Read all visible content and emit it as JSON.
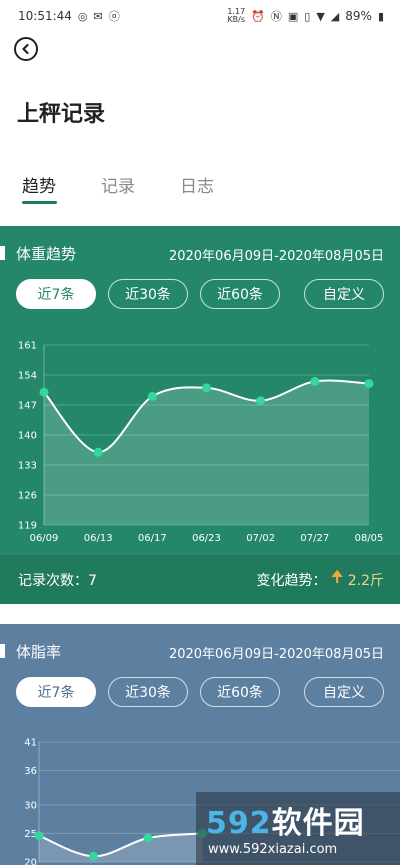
{
  "status_bar": {
    "time": "10:51:44",
    "net_speed_value": "1.17",
    "net_speed_unit": "KB/s",
    "battery": "89%"
  },
  "header": {
    "title": "上秤记录"
  },
  "tabs": [
    {
      "label": "趋势",
      "active": true
    },
    {
      "label": "记录",
      "active": false
    },
    {
      "label": "日志",
      "active": false
    }
  ],
  "colors": {
    "accent": "#1c7d5a",
    "weight_card": "#24876a",
    "fat_card": "#5d7fa0",
    "point": "#35d89a",
    "trend_arrow": "#f2a43a"
  },
  "weight_card": {
    "title": "体重趋势",
    "date_range": "2020年06月09日-2020年08月05日",
    "filters": [
      {
        "label": "近7条",
        "active": true
      },
      {
        "label": "近30条",
        "active": false
      },
      {
        "label": "近60条",
        "active": false
      },
      {
        "label": "自定义",
        "active": false
      }
    ],
    "record_count_label": "记录次数：",
    "record_count": "7",
    "trend_label": "变化趋势：",
    "trend_arrow": "up-arrow-icon",
    "trend_value": "2.2斤"
  },
  "fat_card": {
    "title": "体脂率",
    "date_range": "2020年06月09日-2020年08月05日",
    "filters": [
      {
        "label": "近7条",
        "active": true
      },
      {
        "label": "近30条",
        "active": false
      },
      {
        "label": "近60条",
        "active": false
      },
      {
        "label": "自定义",
        "active": false
      }
    ]
  },
  "chart_data": [
    {
      "type": "area",
      "title": "体重趋势",
      "categories": [
        "06/09",
        "06/13",
        "06/17",
        "06/23",
        "07/02",
        "07/27",
        "08/05"
      ],
      "values": [
        150,
        136,
        149,
        151,
        148,
        152.5,
        152
      ],
      "y_ticks": [
        119,
        126,
        133,
        140,
        147,
        154,
        161
      ],
      "ylim": [
        119,
        161
      ],
      "grid": true
    },
    {
      "type": "area",
      "title": "体脂率",
      "categories": [],
      "values": [
        24.6,
        21,
        24.2,
        25
      ],
      "y_ticks": [
        20,
        25,
        30,
        36,
        41
      ],
      "ylim": [
        20,
        41
      ],
      "grid": true
    }
  ],
  "watermark": {
    "brand_num": "592",
    "brand_text": "软件园",
    "url": "www.592xiazai.com"
  }
}
